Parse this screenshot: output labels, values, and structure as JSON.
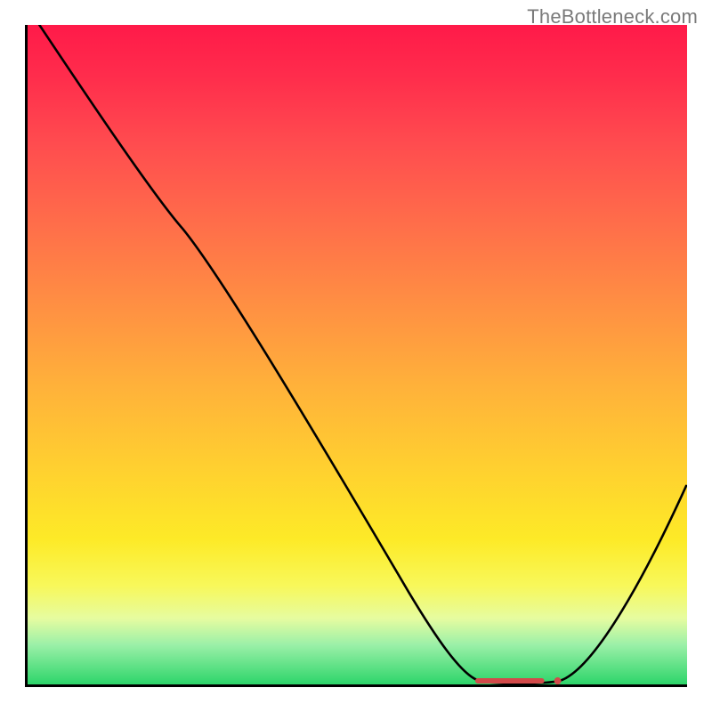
{
  "watermark": "TheBottleneck.com",
  "chart_data": {
    "type": "line",
    "title": "",
    "xlabel": "",
    "ylabel": "",
    "xlim": [
      0,
      100
    ],
    "ylim": [
      0,
      100
    ],
    "grid": false,
    "legend": false,
    "background": {
      "gradient_direction": "vertical",
      "stops": [
        {
          "pos": 0,
          "color": "#ff1a49"
        },
        {
          "pos": 18,
          "color": "#ff4c4f"
        },
        {
          "pos": 42,
          "color": "#ff8e43"
        },
        {
          "pos": 68,
          "color": "#ffd22f"
        },
        {
          "pos": 85,
          "color": "#f8f85a"
        },
        {
          "pos": 94,
          "color": "#9bf0a8"
        },
        {
          "pos": 100,
          "color": "#2dd56a"
        }
      ]
    },
    "series": [
      {
        "name": "bottleneck-curve",
        "x": [
          2,
          10,
          20,
          25,
          35,
          50,
          60,
          67,
          72,
          78,
          82,
          90,
          100
        ],
        "y": [
          100,
          90,
          72,
          68,
          55,
          30,
          13,
          3,
          0,
          0,
          1,
          15,
          30
        ]
      }
    ],
    "annotations": [
      {
        "name": "optimal-range",
        "kind": "segment",
        "x_start": 68,
        "x_end": 80,
        "y": 0,
        "color": "#d24a4a"
      }
    ]
  }
}
